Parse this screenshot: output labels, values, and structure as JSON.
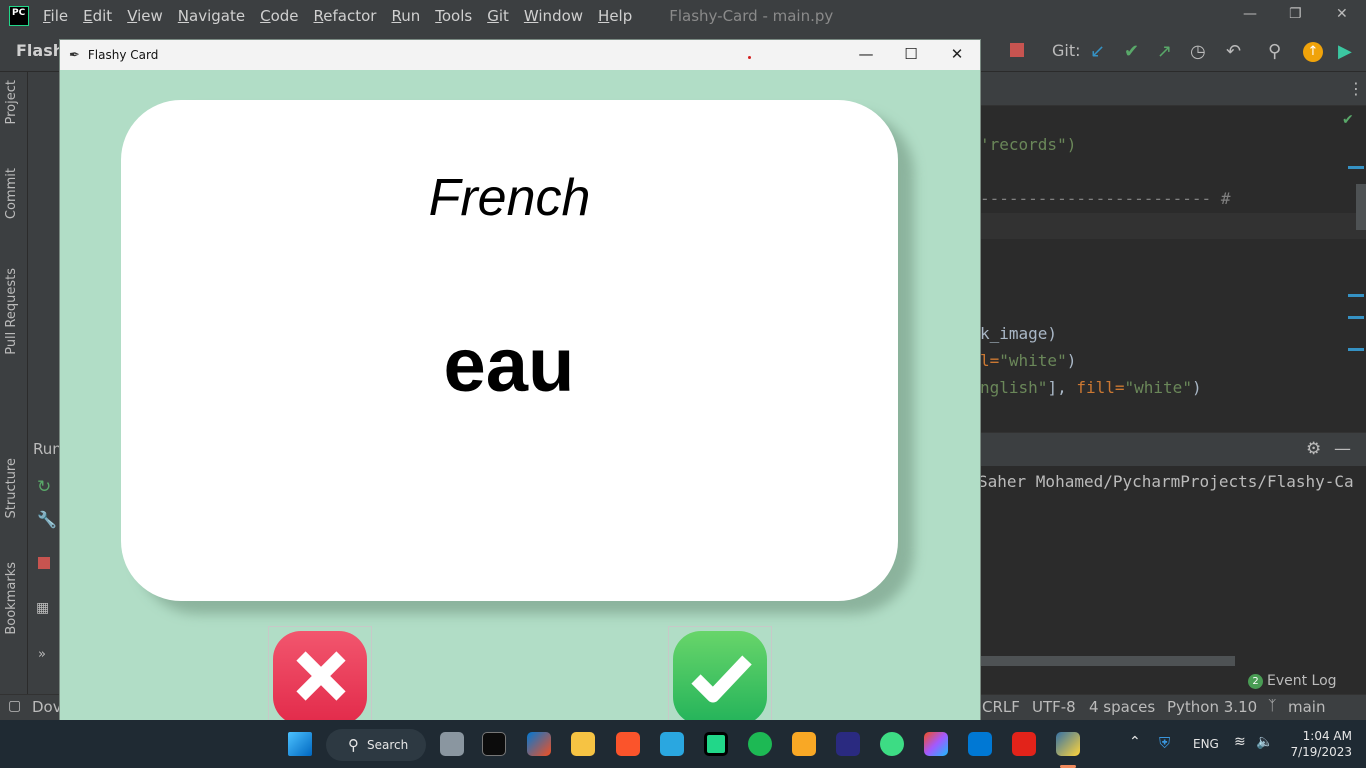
{
  "ide": {
    "menu": [
      "File",
      "Edit",
      "View",
      "Navigate",
      "Code",
      "Refactor",
      "Run",
      "Tools",
      "Git",
      "Window",
      "Help"
    ],
    "menu_mnemonics": [
      "F",
      "E",
      "V",
      "N",
      "C",
      "R",
      "R",
      "T",
      "G",
      "W",
      "H"
    ],
    "window_title": "Flashy-Card - main.py",
    "logo_text": "PC",
    "project_name": "Flashy",
    "git_label": "Git:",
    "left_tabs": [
      "Project",
      "Commit",
      "Pull Requests",
      "Structure",
      "Bookmarks"
    ],
    "run_label": "Run",
    "code_lines": [
      {
        "seg": [
          {
            "t": "'records\")",
            "c": "str"
          }
        ]
      },
      {
        "seg": [
          {
            "t": "------------------------ #",
            "c": "cmt"
          }
        ]
      },
      {
        "seg": [
          {
            "t": "k_image)",
            "c": ""
          }
        ]
      },
      {
        "seg": [
          {
            "t": "l=",
            "c": "kw"
          },
          {
            "t": "\"white\"",
            "c": "str"
          },
          {
            "t": ")",
            "c": ""
          }
        ]
      },
      {
        "seg": [
          {
            "t": "nglish\"",
            "c": "str"
          },
          {
            "t": "], ",
            "c": ""
          },
          {
            "t": "fill=",
            "c": "kw"
          },
          {
            "t": "\"white\"",
            "c": "str"
          },
          {
            "t": ")",
            "c": ""
          }
        ]
      }
    ],
    "run_path": "Saher Mohamed/PycharmProjects/Flashy-Ca",
    "event_log": {
      "count": "2",
      "label": "Event Log"
    },
    "status": {
      "left": "Dov",
      "line_sep": "CRLF",
      "encoding": "UTF-8",
      "indent": "4 spaces",
      "interpreter": "Python 3.10",
      "branch": "main"
    }
  },
  "flashy": {
    "window_title": "Flashy Card",
    "card_title": "French",
    "card_word": "eau"
  },
  "taskbar": {
    "search_label": "Search",
    "language": "ENG",
    "time": "1:04 AM",
    "date": "7/19/2023"
  },
  "colors": {
    "card_background": "#B1DDC6",
    "wrong_button": "#E22A4A",
    "right_button": "#23B35A"
  }
}
